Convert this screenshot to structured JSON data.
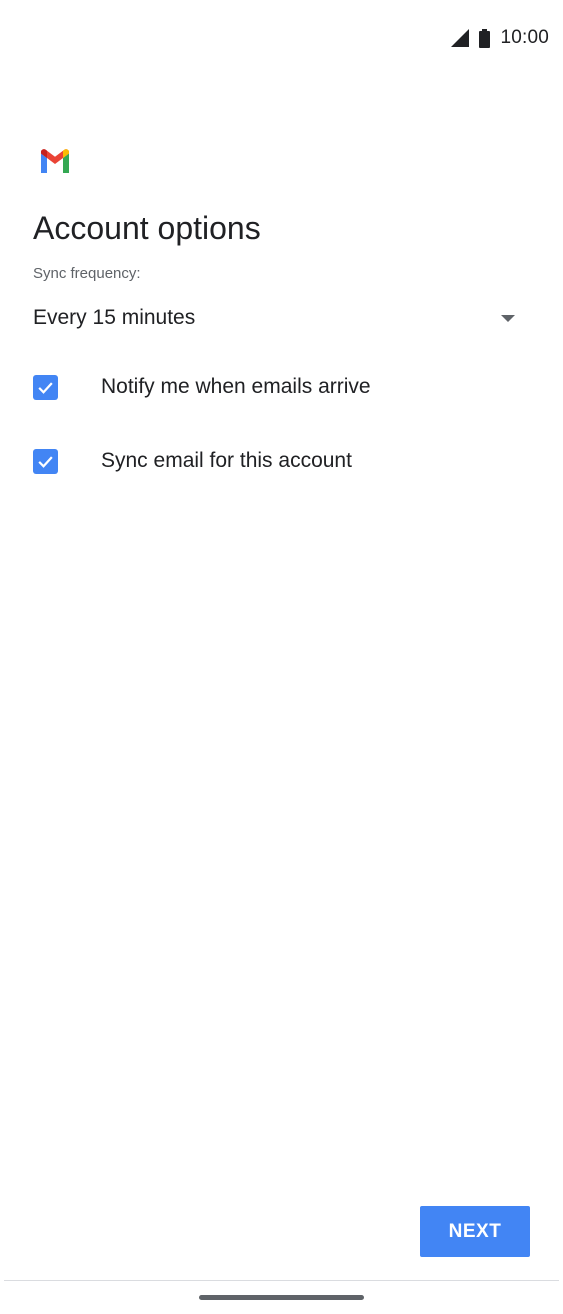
{
  "status_bar": {
    "time": "10:00",
    "icons": [
      "signal-icon",
      "battery-icon"
    ]
  },
  "app": {
    "logo": "gmail-logo"
  },
  "page": {
    "title": "Account options"
  },
  "sync": {
    "label": "Sync frequency:",
    "selected": "Every 15 minutes"
  },
  "options": [
    {
      "label": "Notify me when emails arrive",
      "checked": true
    },
    {
      "label": "Sync email for this account",
      "checked": true
    }
  ],
  "actions": {
    "next_label": "NEXT"
  },
  "colors": {
    "accent": "#4285f4",
    "text_primary": "#202124",
    "text_secondary": "#5f6368",
    "background": "#ffffff"
  }
}
